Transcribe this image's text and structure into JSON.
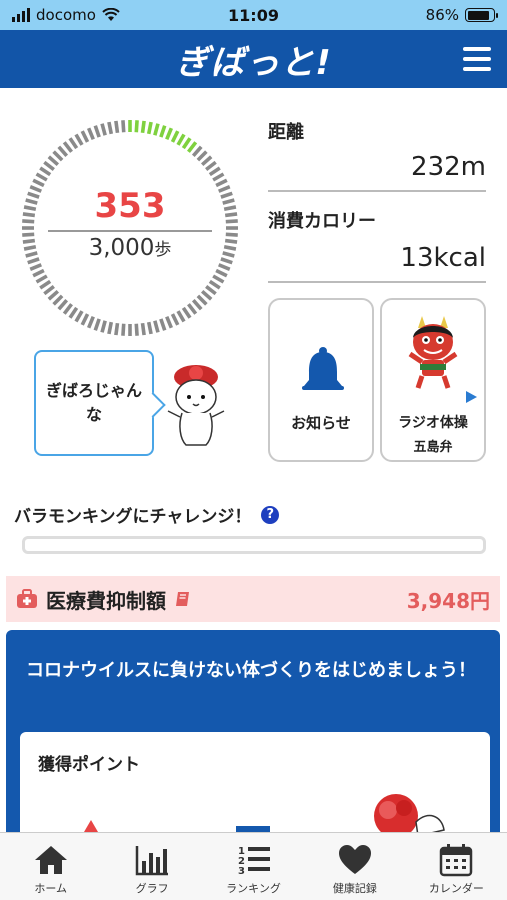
{
  "status_bar": {
    "carrier": "docomo",
    "time": "11:09",
    "battery": "86%",
    "battery_level": 0.86
  },
  "header": {
    "logo": "ぎばっと!",
    "menu_icon": "hamburger-menu-icon"
  },
  "steps": {
    "current": "353",
    "goal": "3,000",
    "unit": "歩",
    "progress_fraction": 0.1177
  },
  "stats": {
    "distance_label": "距離",
    "distance_value": "232m",
    "calorie_label": "消費カロリー",
    "calorie_value": "13kcal"
  },
  "cards": {
    "notice_label": "お知らせ",
    "notice_icon": "bell-icon",
    "radio_label": "ラジオ体操",
    "radio_sub": "五島弁",
    "radio_icon": "oni-mascot-icon"
  },
  "speech_bubble": {
    "text": "ぎばろじゃんな"
  },
  "challenge": {
    "title": "バラモンキングにチャレンジ！",
    "help": "?",
    "progress": 0
  },
  "medical": {
    "label": "医療費抑制額",
    "value": "3,948円",
    "icon": "medical-kit-icon"
  },
  "campaign": {
    "text": "コロナウイルスに負けない体づくりをはじめましょう！"
  },
  "points": {
    "title": "獲得ポイント"
  },
  "tabs": [
    {
      "label": "ホーム",
      "icon": "home-icon"
    },
    {
      "label": "グラフ",
      "icon": "bar-chart-icon"
    },
    {
      "label": "ランキング",
      "icon": "ranking-list-icon"
    },
    {
      "label": "健康記録",
      "icon": "heart-icon"
    },
    {
      "label": "カレンダー",
      "icon": "calendar-icon"
    }
  ],
  "colors": {
    "header": "#1255a8",
    "accent_red": "#e84545",
    "ring_progress": "#7fd13f",
    "ring_track": "#8a8a8a"
  }
}
